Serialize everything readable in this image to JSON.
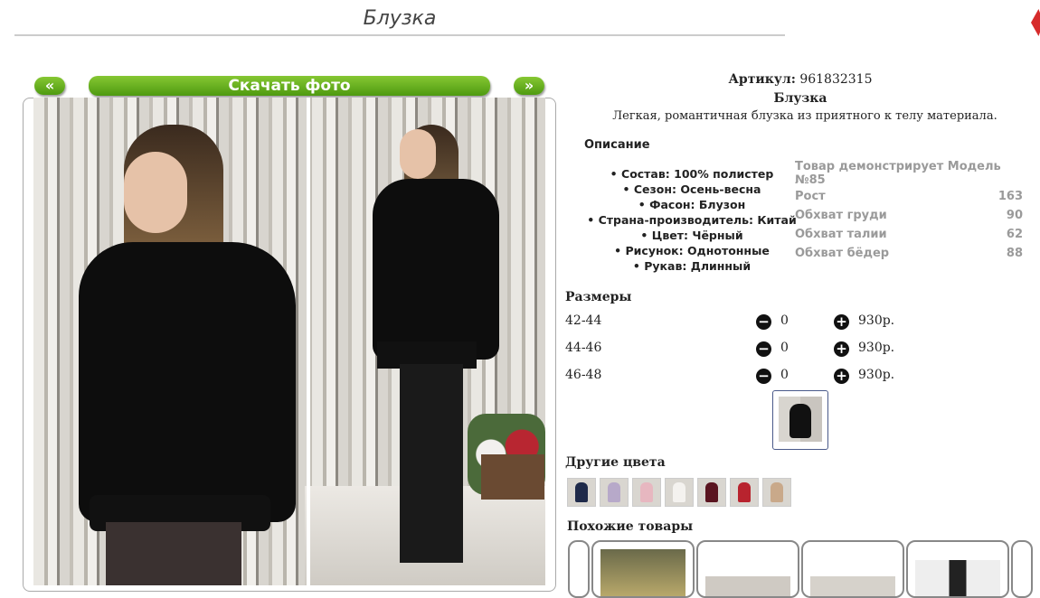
{
  "page": {
    "title": "Блузка"
  },
  "gallery": {
    "prev_label": "«",
    "download_label": "Скачать фото",
    "next_label": "»"
  },
  "product": {
    "article_label": "Артикул:",
    "article_value": "961832315",
    "name": "Блузка",
    "short_desc": "Легкая, романтичная блузка из приятного к телу материала."
  },
  "description": {
    "heading": "Описание",
    "items": [
      "Состав: 100% полистер",
      "Сезон: Осень-весна",
      "Фасон: Блузон",
      "Страна-производитель: Китай",
      "Цвет: Чёрный",
      "Рисунок: Однотонные",
      "Рукав: Длинный"
    ]
  },
  "model": {
    "heading": "Товар демонстрирует Модель №85",
    "rows": [
      {
        "label": "Рост",
        "value": "163"
      },
      {
        "label": "Обхват груди",
        "value": "90"
      },
      {
        "label": "Обхват талии",
        "value": "62"
      },
      {
        "label": "Обхват бёдер",
        "value": "88"
      }
    ]
  },
  "sizes": {
    "heading": "Размеры",
    "rows": [
      {
        "size": "42-44",
        "qty": "0",
        "price": "930р."
      },
      {
        "size": "44-46",
        "qty": "0",
        "price": "930р."
      },
      {
        "size": "46-48",
        "qty": "0",
        "price": "930р."
      }
    ]
  },
  "other_colors": {
    "heading": "Другие цвета",
    "swatches": [
      "navy",
      "lilac",
      "pink",
      "white",
      "burgundy",
      "red",
      "beige"
    ],
    "swatch_colors": [
      "#1f2a4a",
      "#b7a9c9",
      "#e7b7c0",
      "#f4f2ef",
      "#5a1420",
      "#b8232e",
      "#c9a98a"
    ]
  },
  "similar": {
    "heading": "Похожие товары"
  },
  "icons": {
    "minus": "minus-circle-icon",
    "plus": "plus-circle-icon"
  }
}
